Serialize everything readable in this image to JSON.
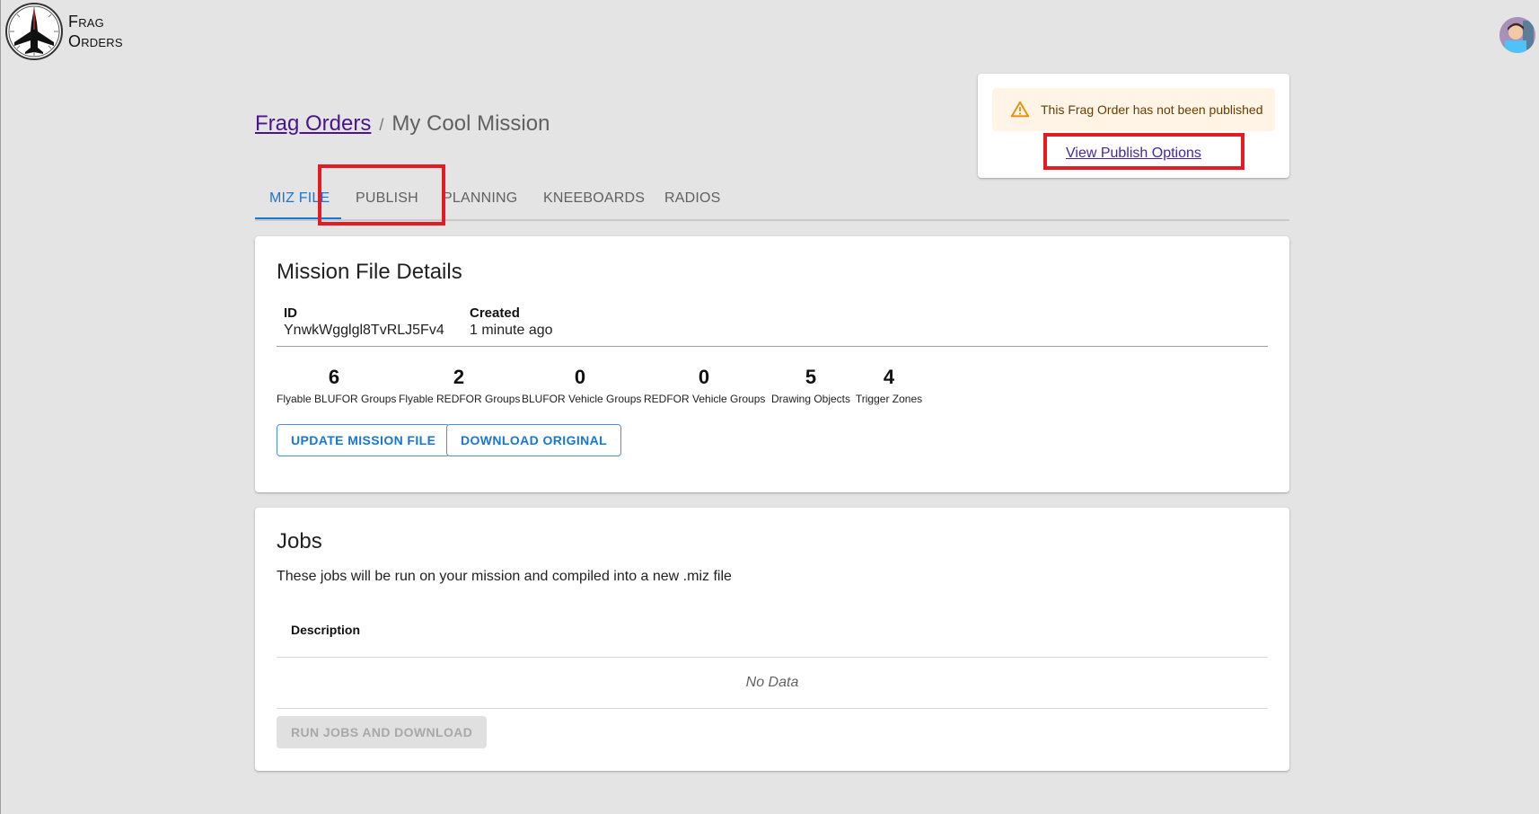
{
  "app": {
    "logo_line1": "Frag",
    "logo_line2": "Orders"
  },
  "notice": {
    "message": "This Frag Order has not been published",
    "link_label": "View Publish Options"
  },
  "breadcrumb": {
    "root": "Frag Orders",
    "separator": "/",
    "current": "My Cool Mission"
  },
  "tabs": [
    {
      "label": "MIZ FILE",
      "active": true
    },
    {
      "label": "PUBLISH",
      "active": false
    },
    {
      "label": "PLANNING",
      "active": false
    },
    {
      "label": "KNEEBOARDS",
      "active": false
    },
    {
      "label": "RADIOS",
      "active": false
    }
  ],
  "mission_file": {
    "title": "Mission File Details",
    "id_label": "ID",
    "id_value": "YnwkWgglgl8TvRLJ5Fv4",
    "created_label": "Created",
    "created_value": "1 minute ago",
    "stats": [
      {
        "value": "6",
        "label": "Flyable BLUFOR Groups"
      },
      {
        "value": "2",
        "label": "Flyable REDFOR Groups"
      },
      {
        "value": "0",
        "label": "BLUFOR Vehicle Groups"
      },
      {
        "value": "0",
        "label": "REDFOR Vehicle Groups"
      },
      {
        "value": "5",
        "label": "Drawing Objects"
      },
      {
        "value": "4",
        "label": "Trigger Zones"
      }
    ],
    "update_button": "UPDATE MISSION FILE",
    "download_button": "DOWNLOAD ORIGINAL"
  },
  "jobs": {
    "title": "Jobs",
    "description": "These jobs will be run on your mission and compiled into a new .miz file",
    "column_description": "Description",
    "empty_text": "No Data",
    "run_button": "RUN JOBS AND DOWNLOAD"
  },
  "colors": {
    "accent": "#1976d2",
    "link": "#4a148c",
    "highlight": "#e41b23",
    "warning_bg": "#fff4e5",
    "warning_icon": "#ed8b00"
  }
}
